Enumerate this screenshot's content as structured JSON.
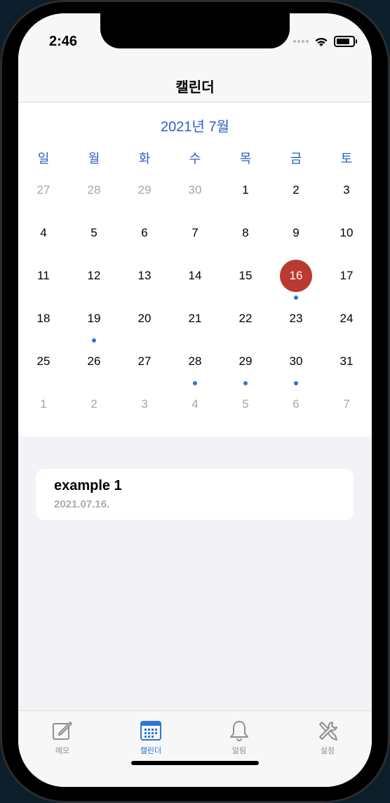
{
  "status_bar": {
    "time": "2:46"
  },
  "nav": {
    "title": "캘린더"
  },
  "calendar": {
    "month_label": "2021년 7월",
    "weekdays": [
      "일",
      "월",
      "화",
      "수",
      "목",
      "금",
      "토"
    ],
    "weeks": [
      [
        {
          "d": "27",
          "out": true
        },
        {
          "d": "28",
          "out": true
        },
        {
          "d": "29",
          "out": true
        },
        {
          "d": "30",
          "out": true
        },
        {
          "d": "1"
        },
        {
          "d": "2"
        },
        {
          "d": "3"
        }
      ],
      [
        {
          "d": "4"
        },
        {
          "d": "5"
        },
        {
          "d": "6"
        },
        {
          "d": "7"
        },
        {
          "d": "8"
        },
        {
          "d": "9"
        },
        {
          "d": "10"
        }
      ],
      [
        {
          "d": "11"
        },
        {
          "d": "12"
        },
        {
          "d": "13"
        },
        {
          "d": "14"
        },
        {
          "d": "15"
        },
        {
          "d": "16",
          "today": true,
          "dot": true
        },
        {
          "d": "17"
        }
      ],
      [
        {
          "d": "18"
        },
        {
          "d": "19",
          "dot": true
        },
        {
          "d": "20"
        },
        {
          "d": "21"
        },
        {
          "d": "22"
        },
        {
          "d": "23"
        },
        {
          "d": "24"
        }
      ],
      [
        {
          "d": "25"
        },
        {
          "d": "26"
        },
        {
          "d": "27"
        },
        {
          "d": "28",
          "dot": true
        },
        {
          "d": "29",
          "dot": true
        },
        {
          "d": "30",
          "dot": true
        },
        {
          "d": "31"
        }
      ],
      [
        {
          "d": "1",
          "out": true
        },
        {
          "d": "2",
          "out": true
        },
        {
          "d": "3",
          "out": true
        },
        {
          "d": "4",
          "out": true
        },
        {
          "d": "5",
          "out": true
        },
        {
          "d": "6",
          "out": true
        },
        {
          "d": "7",
          "out": true
        }
      ]
    ],
    "colors": {
      "accent": "#2c5fc4",
      "today": "#b83a30",
      "event_dot": "#2f75d6"
    }
  },
  "memo_card": {
    "title": "example 1",
    "date": "2021.07.16."
  },
  "tabbar": {
    "items": [
      {
        "label": "메모",
        "icon": "memo-icon",
        "active": false
      },
      {
        "label": "캘린더",
        "icon": "calendar-icon",
        "active": true
      },
      {
        "label": "알림",
        "icon": "bell-icon",
        "active": false
      },
      {
        "label": "설정",
        "icon": "settings-tools-icon",
        "active": false
      }
    ]
  }
}
